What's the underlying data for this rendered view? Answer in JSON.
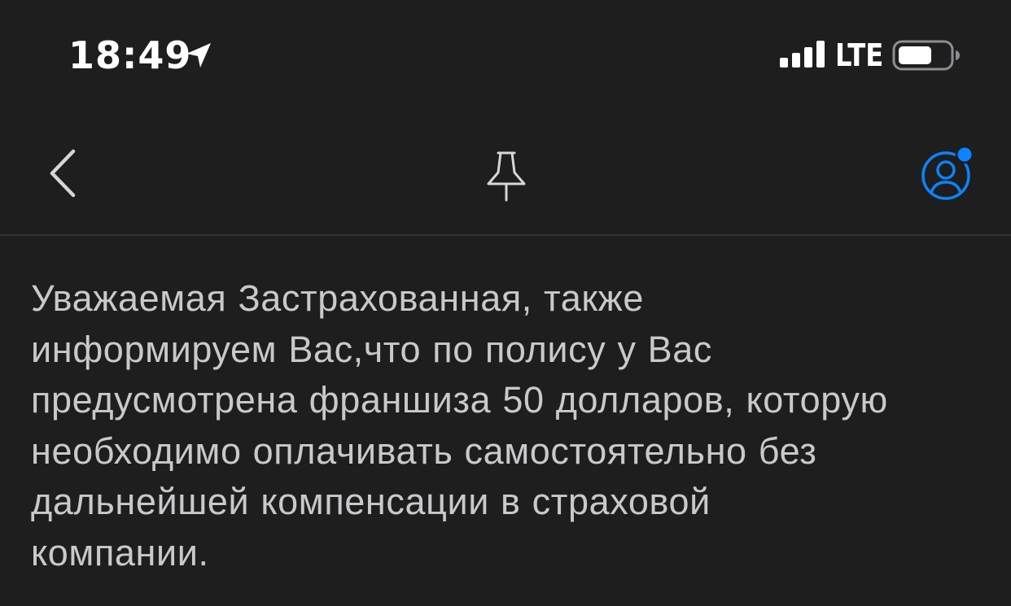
{
  "status_bar": {
    "time": "18:49",
    "network": "LTE",
    "icons": {
      "location": "location-arrow-icon",
      "signal": "cellular-signal-icon",
      "battery": "battery-icon"
    }
  },
  "nav_bar": {
    "icons": {
      "back": "chevron-left-icon",
      "pin": "pin-icon",
      "profile": "user-profile-icon"
    },
    "colors": {
      "accent": "#0a84ff",
      "icon": "#d6d6d8"
    }
  },
  "message": {
    "lines": [
      "Уважаемая Застрахованная, также",
      "информируем Вас,что по полису у Вас",
      "предусмотрена франшиза 50 долларов, которую",
      "необходимо оплачивать самостоятельно без",
      "дальнейшей компенсации в страховой",
      "компании."
    ]
  },
  "theme": {
    "background": "#1e1e1f",
    "text": "#c9c9cc"
  }
}
